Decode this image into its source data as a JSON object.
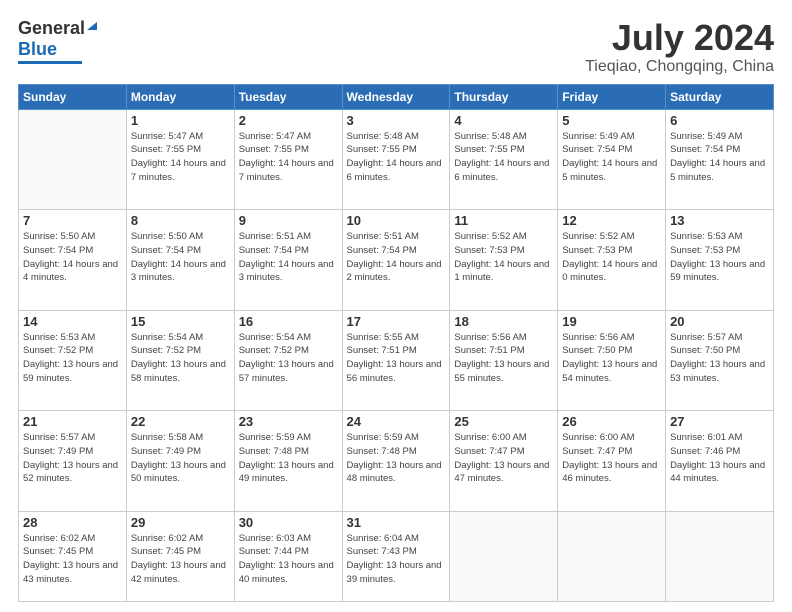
{
  "header": {
    "logo": {
      "general": "General",
      "blue": "Blue"
    },
    "title": "July 2024",
    "location": "Tieqiao, Chongqing, China"
  },
  "calendar": {
    "days_of_week": [
      "Sunday",
      "Monday",
      "Tuesday",
      "Wednesday",
      "Thursday",
      "Friday",
      "Saturday"
    ],
    "weeks": [
      [
        {
          "day": "",
          "info": ""
        },
        {
          "day": "1",
          "info": "Sunrise: 5:47 AM\nSunset: 7:55 PM\nDaylight: 14 hours\nand 7 minutes."
        },
        {
          "day": "2",
          "info": "Sunrise: 5:47 AM\nSunset: 7:55 PM\nDaylight: 14 hours\nand 7 minutes."
        },
        {
          "day": "3",
          "info": "Sunrise: 5:48 AM\nSunset: 7:55 PM\nDaylight: 14 hours\nand 6 minutes."
        },
        {
          "day": "4",
          "info": "Sunrise: 5:48 AM\nSunset: 7:55 PM\nDaylight: 14 hours\nand 6 minutes."
        },
        {
          "day": "5",
          "info": "Sunrise: 5:49 AM\nSunset: 7:54 PM\nDaylight: 14 hours\nand 5 minutes."
        },
        {
          "day": "6",
          "info": "Sunrise: 5:49 AM\nSunset: 7:54 PM\nDaylight: 14 hours\nand 5 minutes."
        }
      ],
      [
        {
          "day": "7",
          "info": "Sunrise: 5:50 AM\nSunset: 7:54 PM\nDaylight: 14 hours\nand 4 minutes."
        },
        {
          "day": "8",
          "info": "Sunrise: 5:50 AM\nSunset: 7:54 PM\nDaylight: 14 hours\nand 3 minutes."
        },
        {
          "day": "9",
          "info": "Sunrise: 5:51 AM\nSunset: 7:54 PM\nDaylight: 14 hours\nand 3 minutes."
        },
        {
          "day": "10",
          "info": "Sunrise: 5:51 AM\nSunset: 7:54 PM\nDaylight: 14 hours\nand 2 minutes."
        },
        {
          "day": "11",
          "info": "Sunrise: 5:52 AM\nSunset: 7:53 PM\nDaylight: 14 hours\nand 1 minute."
        },
        {
          "day": "12",
          "info": "Sunrise: 5:52 AM\nSunset: 7:53 PM\nDaylight: 14 hours\nand 0 minutes."
        },
        {
          "day": "13",
          "info": "Sunrise: 5:53 AM\nSunset: 7:53 PM\nDaylight: 13 hours\nand 59 minutes."
        }
      ],
      [
        {
          "day": "14",
          "info": "Sunrise: 5:53 AM\nSunset: 7:52 PM\nDaylight: 13 hours\nand 59 minutes."
        },
        {
          "day": "15",
          "info": "Sunrise: 5:54 AM\nSunset: 7:52 PM\nDaylight: 13 hours\nand 58 minutes."
        },
        {
          "day": "16",
          "info": "Sunrise: 5:54 AM\nSunset: 7:52 PM\nDaylight: 13 hours\nand 57 minutes."
        },
        {
          "day": "17",
          "info": "Sunrise: 5:55 AM\nSunset: 7:51 PM\nDaylight: 13 hours\nand 56 minutes."
        },
        {
          "day": "18",
          "info": "Sunrise: 5:56 AM\nSunset: 7:51 PM\nDaylight: 13 hours\nand 55 minutes."
        },
        {
          "day": "19",
          "info": "Sunrise: 5:56 AM\nSunset: 7:50 PM\nDaylight: 13 hours\nand 54 minutes."
        },
        {
          "day": "20",
          "info": "Sunrise: 5:57 AM\nSunset: 7:50 PM\nDaylight: 13 hours\nand 53 minutes."
        }
      ],
      [
        {
          "day": "21",
          "info": "Sunrise: 5:57 AM\nSunset: 7:49 PM\nDaylight: 13 hours\nand 52 minutes."
        },
        {
          "day": "22",
          "info": "Sunrise: 5:58 AM\nSunset: 7:49 PM\nDaylight: 13 hours\nand 50 minutes."
        },
        {
          "day": "23",
          "info": "Sunrise: 5:59 AM\nSunset: 7:48 PM\nDaylight: 13 hours\nand 49 minutes."
        },
        {
          "day": "24",
          "info": "Sunrise: 5:59 AM\nSunset: 7:48 PM\nDaylight: 13 hours\nand 48 minutes."
        },
        {
          "day": "25",
          "info": "Sunrise: 6:00 AM\nSunset: 7:47 PM\nDaylight: 13 hours\nand 47 minutes."
        },
        {
          "day": "26",
          "info": "Sunrise: 6:00 AM\nSunset: 7:47 PM\nDaylight: 13 hours\nand 46 minutes."
        },
        {
          "day": "27",
          "info": "Sunrise: 6:01 AM\nSunset: 7:46 PM\nDaylight: 13 hours\nand 44 minutes."
        }
      ],
      [
        {
          "day": "28",
          "info": "Sunrise: 6:02 AM\nSunset: 7:45 PM\nDaylight: 13 hours\nand 43 minutes."
        },
        {
          "day": "29",
          "info": "Sunrise: 6:02 AM\nSunset: 7:45 PM\nDaylight: 13 hours\nand 42 minutes."
        },
        {
          "day": "30",
          "info": "Sunrise: 6:03 AM\nSunset: 7:44 PM\nDaylight: 13 hours\nand 40 minutes."
        },
        {
          "day": "31",
          "info": "Sunrise: 6:04 AM\nSunset: 7:43 PM\nDaylight: 13 hours\nand 39 minutes."
        },
        {
          "day": "",
          "info": ""
        },
        {
          "day": "",
          "info": ""
        },
        {
          "day": "",
          "info": ""
        }
      ]
    ]
  }
}
